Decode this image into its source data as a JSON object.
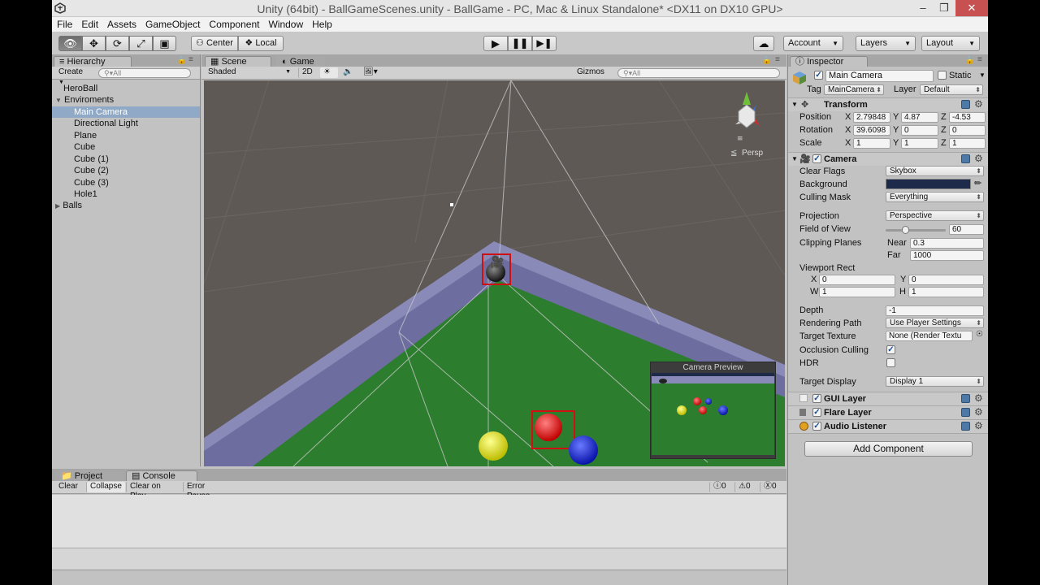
{
  "window": {
    "title": "Unity (64bit) - BallGameScenes.unity - BallGame - PC, Mac & Linux Standalone* <DX11 on DX10 GPU>",
    "unity_logo_icon": "unity-logo-icon"
  },
  "menu": [
    "File",
    "Edit",
    "Assets",
    "GameObject",
    "Component",
    "Window",
    "Help"
  ],
  "toolbar": {
    "tools": [
      "hand",
      "move",
      "rotate",
      "scale",
      "rect"
    ],
    "center": "Center",
    "local": "Local",
    "account": "Account",
    "layers": "Layers",
    "layout": "Layout"
  },
  "hierarchy": {
    "tab": "Hierarchy",
    "create": "Create",
    "search": "All",
    "items": [
      {
        "label": "HeroBall",
        "indent": 0
      },
      {
        "label": "Enviroments",
        "indent": 0,
        "expanded": true
      },
      {
        "label": "Main Camera",
        "indent": 1,
        "selected": true
      },
      {
        "label": "Directional Light",
        "indent": 1
      },
      {
        "label": "Plane",
        "indent": 1
      },
      {
        "label": "Cube",
        "indent": 1
      },
      {
        "label": "Cube (1)",
        "indent": 1
      },
      {
        "label": "Cube (2)",
        "indent": 1
      },
      {
        "label": "Cube (3)",
        "indent": 1
      },
      {
        "label": "Hole1",
        "indent": 1
      },
      {
        "label": "Balls",
        "indent": 0,
        "collapsed": true
      }
    ]
  },
  "scene": {
    "tab_scene": "Scene",
    "tab_game": "Game",
    "shading": "Shaded",
    "mode2d": "2D",
    "gizmos": "Gizmos",
    "search": "All",
    "persp": "Persp",
    "preview_title": "Camera Preview",
    "colors": {
      "sky": "#5e5955",
      "table": "#2c7d2e",
      "rail": "#8a8ab8"
    }
  },
  "bottom": {
    "tab_project": "Project",
    "tab_console": "Console",
    "buttons": [
      "Clear",
      "Collapse",
      "Clear on Play",
      "Error Pause"
    ],
    "counts": [
      "0",
      "0",
      "0"
    ]
  },
  "inspector": {
    "tab": "Inspector",
    "object_name": "Main Camera",
    "static": "Static",
    "tag_label": "Tag",
    "tag": "MainCamera",
    "layer_label": "Layer",
    "layer": "Default",
    "transform": {
      "title": "Transform",
      "position_label": "Position",
      "position": [
        "2.79848",
        "4.87",
        "-4.53"
      ],
      "rotation_label": "Rotation",
      "rotation": [
        "39.6098",
        "0",
        "0"
      ],
      "scale_label": "Scale",
      "scale": [
        "1",
        "1",
        "1"
      ],
      "axis": [
        "X",
        "Y",
        "Z"
      ]
    },
    "camera": {
      "title": "Camera",
      "clear_flags_label": "Clear Flags",
      "clear_flags": "Skybox",
      "background_label": "Background",
      "background_color": "#1d2a4a",
      "culling_label": "Culling Mask",
      "culling": "Everything",
      "projection_label": "Projection",
      "projection": "Perspective",
      "fov_label": "Field of View",
      "fov": "60",
      "fov_fraction": 0.33,
      "clipping_label": "Clipping Planes",
      "near_label": "Near",
      "near": "0.3",
      "far_label": "Far",
      "far": "1000",
      "viewport_label": "Viewport Rect",
      "vx_label": "X",
      "vx": "0",
      "vy_label": "Y",
      "vy": "0",
      "vw_label": "W",
      "vw": "1",
      "vh_label": "H",
      "vh": "1",
      "depth_label": "Depth",
      "depth": "-1",
      "rendering_label": "Rendering Path",
      "rendering": "Use Player Settings",
      "target_texture_label": "Target Texture",
      "target_texture": "None (Render Textu",
      "occlusion_label": "Occlusion Culling",
      "hdr_label": "HDR",
      "target_display_label": "Target Display",
      "target_display": "Display 1"
    },
    "components": [
      "GUI Layer",
      "Flare Layer",
      "Audio Listener"
    ],
    "add_component": "Add Component"
  }
}
